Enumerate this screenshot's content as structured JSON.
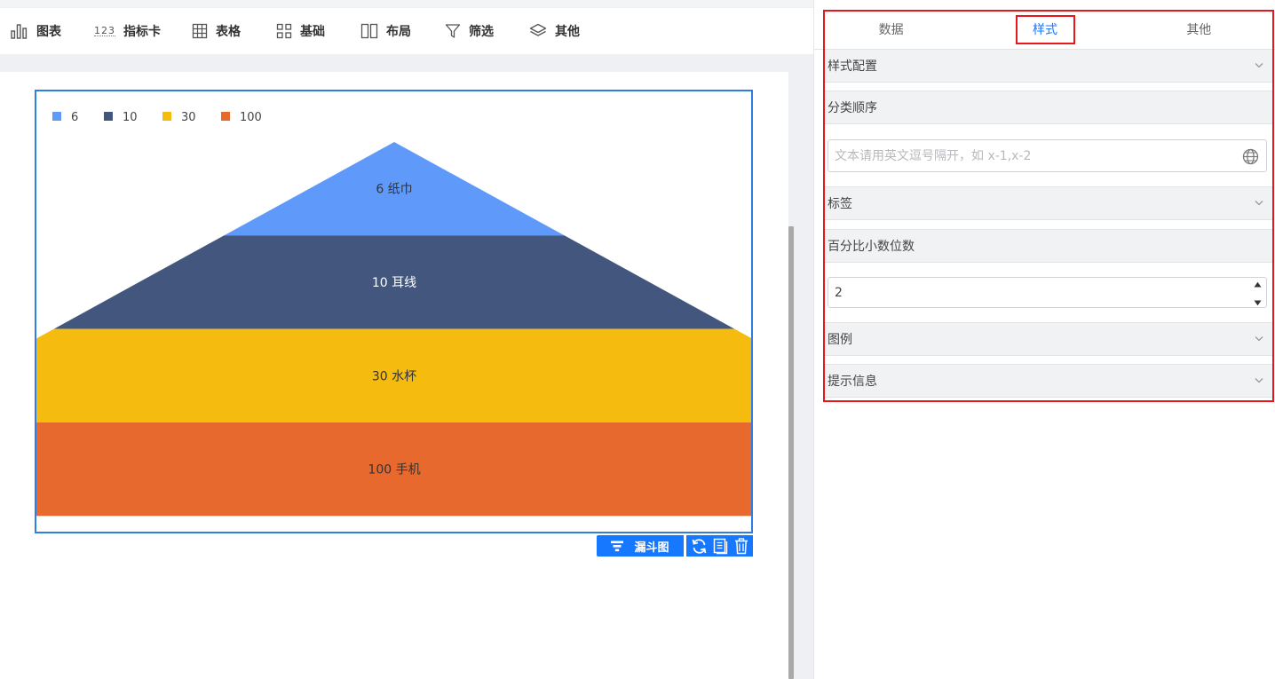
{
  "toolbar": {
    "items": [
      {
        "label": "图表",
        "icon": "bar-chart-icon"
      },
      {
        "label": "指标卡",
        "icon": "number-card-icon",
        "glyph": "123"
      },
      {
        "label": "表格",
        "icon": "table-grid-icon"
      },
      {
        "label": "基础",
        "icon": "basic-widgets-icon"
      },
      {
        "label": "布局",
        "icon": "layout-columns-icon"
      },
      {
        "label": "筛选",
        "icon": "filter-icon"
      },
      {
        "label": "其他",
        "icon": "layers-icon"
      }
    ]
  },
  "chart_data": {
    "type": "funnel",
    "categories": [
      "纸巾",
      "耳线",
      "水杯",
      "手机"
    ],
    "values": [
      6,
      10,
      30,
      100
    ],
    "labels": [
      "6 纸巾",
      "10 耳线",
      "30 水杯",
      "100 手机"
    ],
    "colors": [
      "#5f99fa",
      "#43577e",
      "#f5bc0f",
      "#e7692e"
    ],
    "label_colors": [
      "#333333",
      "#ffffff",
      "#333333",
      "#333333"
    ],
    "legend": {
      "entries": [
        "6",
        "10",
        "30",
        "100"
      ],
      "placement": "top-left"
    },
    "title": ""
  },
  "chart_actions": {
    "type_label": "漏斗图",
    "icons": [
      "refresh-icon",
      "copy-icon",
      "trash-icon"
    ]
  },
  "panel": {
    "tabs": [
      {
        "label": "数据",
        "active": false
      },
      {
        "label": "样式",
        "active": true
      },
      {
        "label": "其他",
        "active": false
      }
    ],
    "sections": {
      "style_config": "样式配置",
      "category_order": "分类顺序",
      "labels": "标签",
      "percent_decimals": "百分比小数位数",
      "legend": "图例",
      "tooltip": "提示信息"
    },
    "category_order_placeholder": "文本请用英文逗号隔开，如 x-1,x-2",
    "percent_decimals_value": "2"
  },
  "colors": {
    "accent": "#1677ff",
    "highlight_border": "#e8151c",
    "chart_border": "#2f7de1"
  }
}
